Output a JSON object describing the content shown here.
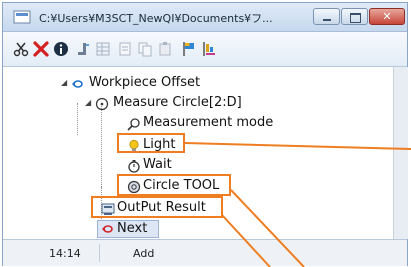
{
  "window": {
    "title": "C:¥Users¥M3SCT_NewQI¥Documents¥フ..."
  },
  "toolbar": {
    "icons": [
      "scissors-icon",
      "delete-icon",
      "info-icon",
      "insert-icon",
      "table-icon",
      "page-icon",
      "copy-icon",
      "paste-icon",
      "flag-icon",
      "flag-chart-icon"
    ]
  },
  "tree": {
    "items": [
      {
        "label": "Workpiece Offset",
        "icon": "loop-icon"
      },
      {
        "label": "Measure Circle[2:D]",
        "icon": "circle-target-icon"
      },
      {
        "label": "Measurement mode",
        "icon": "probe-icon"
      },
      {
        "label": "Light",
        "icon": "bulb-icon"
      },
      {
        "label": "Wait",
        "icon": "stopwatch-icon"
      },
      {
        "label": "Circle TOOL",
        "icon": "circle-tool-icon"
      },
      {
        "label": "OutPut Result",
        "icon": "output-icon"
      },
      {
        "label": "Next",
        "icon": "next-loop-icon"
      }
    ]
  },
  "status": {
    "time": "14:14",
    "mode": "Add"
  },
  "colors": {
    "callout": "#ef7d22",
    "next_highlight": "#dde6f5"
  }
}
